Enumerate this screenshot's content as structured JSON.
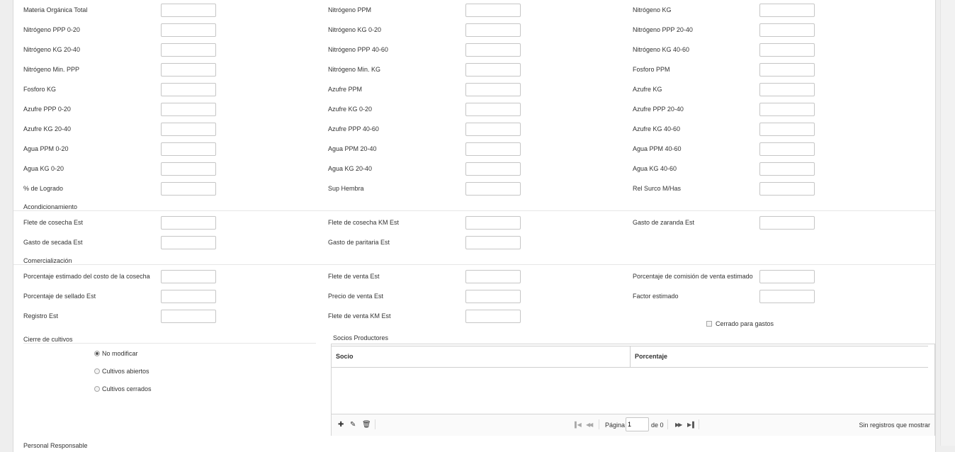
{
  "form": {
    "rows": [
      [
        "Materia Orgánica Total",
        "Nitrógeno PPM",
        "Nitrógeno KG"
      ],
      [
        "Nitrógeno PPP 0-20",
        "Nitrógeno KG 0-20",
        "Nitrógeno PPP 20-40"
      ],
      [
        "Nitrógeno KG 20-40",
        "Nitrógeno PPP 40-60",
        "Nitrógeno KG 40-60"
      ],
      [
        "Nitrógeno Min. PPP",
        "Nitrógeno Min. KG",
        "Fosforo PPM"
      ],
      [
        "Fosforo KG",
        "Azufre PPM",
        "Azufre KG"
      ],
      [
        "Azufre PPP 0-20",
        "Azufre KG 0-20",
        "Azufre PPP 20-40"
      ],
      [
        "Azufre KG 20-40",
        "Azufre PPP 40-60",
        "Azufre KG 40-60"
      ],
      [
        "Agua PPM 0-20",
        "Agua PPM 20-40",
        "Agua PPM 40-60"
      ],
      [
        "Agua KG 0-20",
        "Agua KG 20-40",
        "Agua KG 40-60"
      ],
      [
        "% de Logrado",
        "Sup Hembra",
        "Rel Surco M/Has"
      ]
    ],
    "acondicionamiento": {
      "title": "Acondicionamiento",
      "rows": [
        [
          "Flete de cosecha Est",
          "Flete de cosecha KM Est",
          "Gasto de zaranda Est"
        ],
        [
          "Gasto de secada Est",
          "Gasto de paritaria Est",
          ""
        ]
      ]
    },
    "comercializacion": {
      "title": "Comercialización",
      "rows": [
        [
          "Porcentaje estimado del costo de la cosecha",
          "Flete de venta Est",
          "Porcentaje de comisión de venta estimado"
        ],
        [
          "Porcentaje de sellado Est",
          "Precio de venta Est",
          "Factor estimado"
        ],
        [
          "Registro Est",
          "Flete de venta KM Est",
          ""
        ]
      ]
    },
    "cerrado_gastos_label": "Cerrado para gastos"
  },
  "cierre": {
    "title": "Cierre de cultivos",
    "options": [
      "No modificar",
      "Cultivos abiertos",
      "Cultivos cerrados"
    ],
    "selected_index": 0
  },
  "socios": {
    "title": "Socios Productores",
    "columns": [
      "Socio",
      "Porcentaje"
    ],
    "pager": {
      "page_label": "Página",
      "page_value": "1",
      "of_label": "de 0",
      "empty_message": "Sin registros que mostrar"
    }
  },
  "personal_label": "Personal Responsable"
}
